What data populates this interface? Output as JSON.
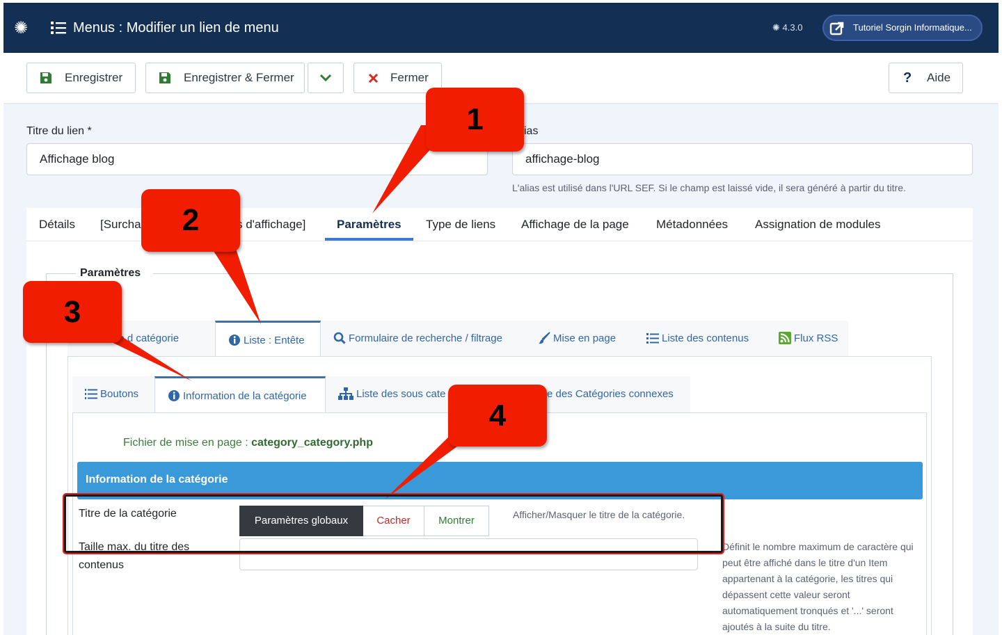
{
  "header": {
    "title": "Menus : Modifier un lien de menu",
    "version": "4.3.0",
    "site_button": "Tutoriel Sorgin Informatique..."
  },
  "toolbar": {
    "save": "Enregistrer",
    "save_close": "Enregistrer & Fermer",
    "close": "Fermer",
    "help": "Aide"
  },
  "form": {
    "title_label": "Titre du lien *",
    "title_value": "Affichage blog",
    "alias_label": "ias",
    "alias_value": "affichage-blog",
    "alias_hint": "L'alias est utilisé dans l'URL SEF. Si le champ est laissé vide, il sera généré à partir du titre."
  },
  "tabs_main": [
    {
      "label": "Détails"
    },
    {
      "label": "[Surcha"
    },
    {
      "label": "s d'affichage]"
    },
    {
      "label": "Paramètres"
    },
    {
      "label": "Type de liens"
    },
    {
      "label": "Affichage de la page"
    },
    {
      "label": "Métadonnées"
    },
    {
      "label": "Assignation de modules"
    }
  ],
  "fieldset_legend": "Paramètres",
  "tabs_sub": [
    {
      "label": "Image d"
    },
    {
      "label": "catégorie"
    },
    {
      "label": "Liste : Entête"
    },
    {
      "label": "Formulaire de recherche / filtrage"
    },
    {
      "label": "Mise en page"
    },
    {
      "label": "Liste des contenus"
    },
    {
      "label": "Flux RSS"
    }
  ],
  "tabs_inner": [
    {
      "label": "Boutons"
    },
    {
      "label": "Information de la catégorie"
    },
    {
      "label": "Liste des sous cate"
    },
    {
      "label": "e des Catégories connexes"
    }
  ],
  "layout_file_label": "Fichier de mise en page :",
  "layout_file_value": "category_category.php",
  "section_title": "Information de la catégorie",
  "fields": {
    "cat_title_label": "Titre de la catégorie",
    "switch": {
      "global": "Paramètres globaux",
      "hide": "Cacher",
      "show": "Montrer"
    },
    "cat_title_desc": "Afficher/Masquer le titre de la catégorie.",
    "max_title_label_line1": "Taille max. du titre des",
    "max_title_label_line2": "contenus",
    "max_title_desc": "Définit le nombre maximum de caractère qui peut être affiché dans le titre d'un Item appartenant à la catégorie, les titres qui dépassent cette valeur seront automatiquement tronqués et '...' seront ajoutés à la suite du titre."
  },
  "callouts": [
    "1",
    "2",
    "3",
    "4"
  ],
  "colors": {
    "header_bg": "#132f53",
    "accent": "#3a9ad9",
    "callout": "#f01d00",
    "danger": "#c52827",
    "success": "#2f7d32"
  }
}
